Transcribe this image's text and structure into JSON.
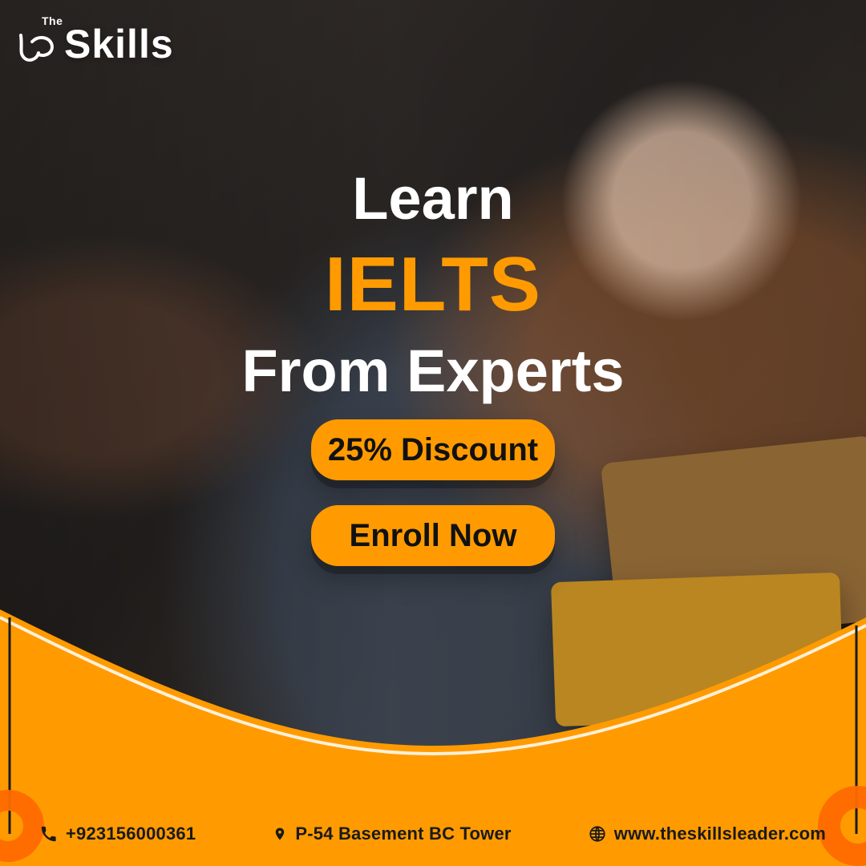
{
  "brand": {
    "logo_small": "The",
    "logo_main": "Skills"
  },
  "headline": {
    "line1": "Learn",
    "line2": "IELTS",
    "line3": "From Experts"
  },
  "cta": {
    "discount": "25% Discount",
    "enroll": "Enroll Now"
  },
  "footer": {
    "phone": "+923156000361",
    "address": "P-54 Basement BC Tower",
    "website": "www.theskillsleader.com"
  },
  "colors": {
    "accent": "#ff9b00",
    "accent_deep": "#ff6a00",
    "text_dark": "#1a1a1a"
  },
  "icons": {
    "phone": "phone-icon",
    "location": "map-pin-icon",
    "globe": "globe-icon"
  }
}
